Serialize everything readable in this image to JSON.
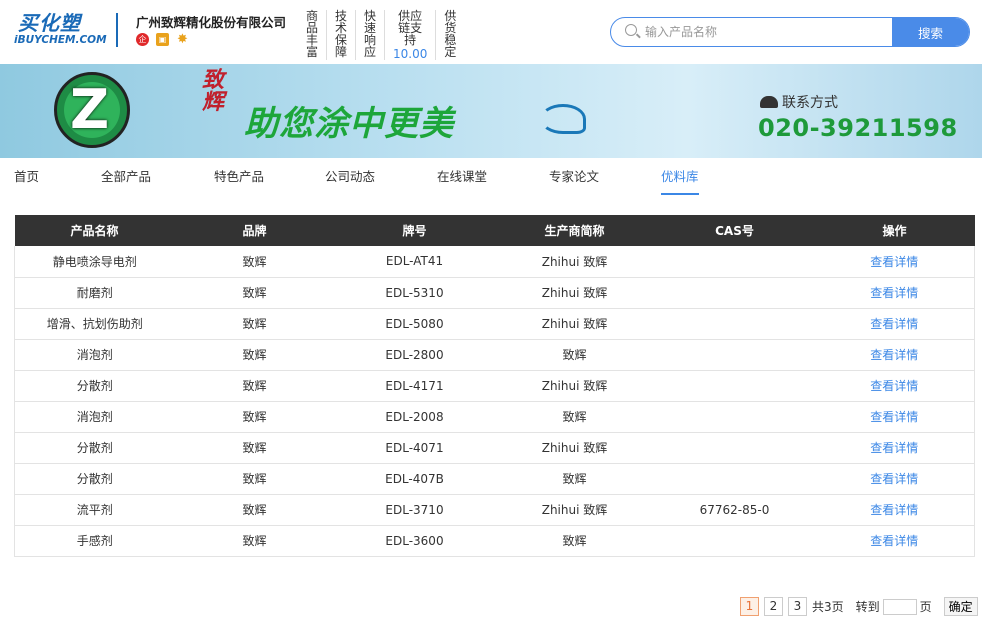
{
  "site": {
    "logo_cn": "买化塑",
    "logo_en": "iBUYCHEM.COM",
    "company": "广州致辉精化股份有限公司"
  },
  "features": [
    {
      "label": "商品丰富",
      "number": ""
    },
    {
      "label": "技术保障",
      "number": ""
    },
    {
      "label": "快速响应",
      "number": ""
    },
    {
      "label": "供应链支持",
      "number": "10.00"
    },
    {
      "label": "供货稳定",
      "number": ""
    }
  ],
  "search": {
    "placeholder": "输入产品名称",
    "button": "搜索"
  },
  "banner": {
    "brand_cn": "致辉",
    "slogan": "助您涂中更美",
    "contact_label": "联系方式",
    "phone": "020-39211598"
  },
  "nav": {
    "items": [
      "首页",
      "全部产品",
      "特色产品",
      "公司动态",
      "在线课堂",
      "专家论文",
      "优料库"
    ],
    "active": "优料库"
  },
  "table": {
    "headers": [
      "产品名称",
      "品牌",
      "牌号",
      "生产商简称",
      "CAS号",
      "操作"
    ],
    "rows": [
      [
        "静电喷涂导电剂",
        "致辉",
        "EDL-AT41",
        "Zhihui 致辉",
        "",
        "查看详情"
      ],
      [
        "耐磨剂",
        "致辉",
        "EDL-5310",
        "Zhihui 致辉",
        "",
        "查看详情"
      ],
      [
        "增滑、抗划伤助剂",
        "致辉",
        "EDL-5080",
        "Zhihui 致辉",
        "",
        "查看详情"
      ],
      [
        "消泡剂",
        "致辉",
        "EDL-2800",
        "致辉",
        "",
        "查看详情"
      ],
      [
        "分散剂",
        "致辉",
        "EDL-4171",
        "Zhihui 致辉",
        "",
        "查看详情"
      ],
      [
        "消泡剂",
        "致辉",
        "EDL-2008",
        "致辉",
        "",
        "查看详情"
      ],
      [
        "分散剂",
        "致辉",
        "EDL-4071",
        "Zhihui 致辉",
        "",
        "查看详情"
      ],
      [
        "分散剂",
        "致辉",
        "EDL-407B",
        "致辉",
        "",
        "查看详情"
      ],
      [
        "流平剂",
        "致辉",
        "EDL-3710",
        "Zhihui 致辉",
        "67762-85-0",
        "查看详情"
      ],
      [
        "手感剂",
        "致辉",
        "EDL-3600",
        "致辉",
        "",
        "查看详情"
      ]
    ]
  },
  "pagination": {
    "pages": [
      "1",
      "2",
      "3"
    ],
    "current": "1",
    "total_label": "共3页",
    "goto_label": "转到",
    "page_unit": "页",
    "confirm": "确定"
  },
  "colors": {
    "accent": "#3b87e6",
    "header_bg": "#333333",
    "brand_green": "#1e9a3a"
  }
}
